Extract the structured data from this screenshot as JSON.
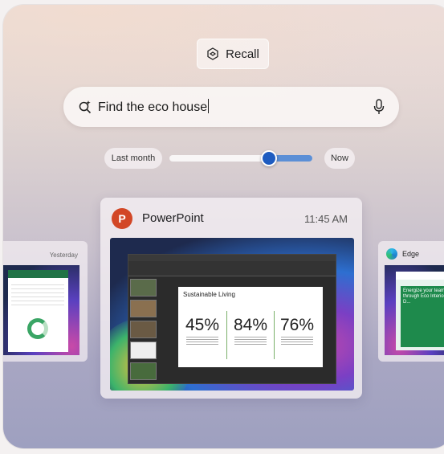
{
  "recall_button": {
    "label": "Recall",
    "icon": "recall-cube-icon"
  },
  "search": {
    "value": "Find the eco house",
    "icon": "search-sparkle-icon",
    "mic_icon": "microphone-icon"
  },
  "timeline": {
    "left_label": "Last month",
    "right_label": "Now",
    "position": 0.72,
    "accent_color": "#1e5cc0"
  },
  "main_snapshot": {
    "app_name": "PowerPoint",
    "time": "11:45 AM",
    "app_icon": "powerpoint-icon",
    "app_icon_letter": "P",
    "slide": {
      "title": "Sustainable Living",
      "stats": [
        "45%",
        "84%",
        "76%"
      ]
    }
  },
  "left_snapshot": {
    "label": "Yesterday",
    "app_icon": "excel-icon"
  },
  "right_snapshot": {
    "app_name": "Edge",
    "app_icon": "edge-icon",
    "web_text": "Energize your team through Eco Interior D..."
  }
}
